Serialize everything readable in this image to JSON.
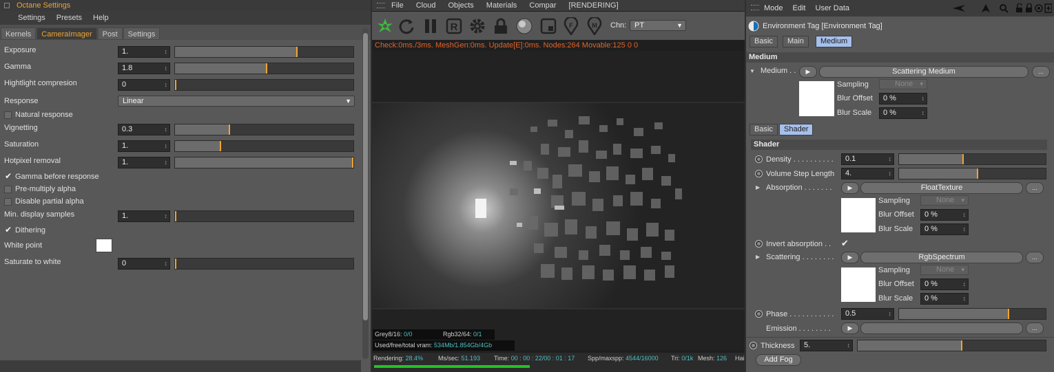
{
  "left": {
    "title": "Octane Settings",
    "menu": [
      "Settings",
      "Presets",
      "Help"
    ],
    "tabs": [
      "Kernels",
      "CameraImager",
      "Post",
      "Settings"
    ],
    "params": {
      "exposure": {
        "label": "Exposure",
        "value": "1.",
        "level": 0.68
      },
      "gamma": {
        "label": "Gamma",
        "value": "1.8",
        "level": 0.51
      },
      "highlight": {
        "label": "Hightlight compresion",
        "value": "0",
        "level": 0
      },
      "response": {
        "label": "Response",
        "value": "Linear"
      },
      "natural": {
        "label": "Natural response"
      },
      "vignetting": {
        "label": "Vignetting",
        "value": "0.3",
        "level": 0.3
      },
      "saturation": {
        "label": "Saturation",
        "value": "1.",
        "level": 0.25
      },
      "hotpixel": {
        "label": "Hotpixel removal",
        "value": "1.",
        "level": 1
      },
      "gamma_before": {
        "label": "Gamma before response"
      },
      "premultiply": {
        "label": "Pre-multiply alpha"
      },
      "disable_partial": {
        "label": "Disable partial alpha"
      },
      "min_display": {
        "label": "Min. display samples",
        "value": "1.",
        "level": 0
      },
      "dithering": {
        "label": "Dithering"
      },
      "white_point": {
        "label": "White point"
      },
      "saturate_white": {
        "label": "Saturate to white",
        "value": "0",
        "level": 0
      }
    }
  },
  "mid": {
    "menu": [
      "File",
      "Cloud",
      "Objects",
      "Materials",
      "Compar",
      "[RENDERING]"
    ],
    "chn_label": "Chn:",
    "chn_value": "PT",
    "status": "Check:0ms./3ms. MeshGen:0ms. Update[E]:0ms. Nodes:264 Movable:125  0 0",
    "info": {
      "grey_label": "Grey8/16:",
      "grey_value": "0/0",
      "rgb_label": "Rgb32/64:",
      "rgb_value": "0/1",
      "vram_label": "Used/free/total vram:",
      "vram_value": "534Mb/1.854Gb/4Gb"
    },
    "bottom": {
      "rendering_label": "Rendering:",
      "rendering_value": "28.4%",
      "ms_label": "Ms/sec:",
      "ms_value": "51.193",
      "time_label": "Time:",
      "time_value": "00 : 00 : 22/00 : 01 : 17",
      "spp_label": "Spp/maxspp:",
      "spp_value": "4544/16000",
      "tri_label": "Tri:",
      "tri_value": "0/1k",
      "mesh_label": "Mesh:",
      "mesh_value": "126",
      "extra": "Hai"
    },
    "progress": 0.284
  },
  "right": {
    "menu": [
      "Mode",
      "Edit",
      "User Data"
    ],
    "tag_title": "Environment Tag [Environment Tag]",
    "tabs": [
      "Basic",
      "Main",
      "Medium"
    ],
    "section_medium": "Medium",
    "medium_label": "Medium . .",
    "medium_value": "Scattering Medium",
    "ellipsis": "...",
    "sampling_label": "Sampling",
    "sampling_value": "None",
    "blur_offset_label": "Blur Offset",
    "blur_offset_value": "0 %",
    "blur_scale_label": "Blur Scale",
    "blur_scale_value": "0 %",
    "subtabs": [
      "Basic",
      "Shader"
    ],
    "section_shader": "Shader",
    "density": {
      "label": "Density . . . . . . . . . .",
      "value": "0.1",
      "level": 0.43
    },
    "volume_step": {
      "label": "Volume Step Length",
      "value": "4.",
      "level": 0.53
    },
    "absorption": {
      "label": "Absorption . . . . . . .",
      "value": "FloatTexture"
    },
    "invert_absorption": {
      "label": "Invert absorption . ."
    },
    "scattering": {
      "label": "Scattering . . . . . . . .",
      "value": "RgbSpectrum"
    },
    "phase": {
      "label": "Phase . . . . . . . . . . .",
      "value": "0.5",
      "level": 0.74
    },
    "emission": {
      "label": "Emission . . . . . . . ."
    },
    "thickness": {
      "label": "Thickness",
      "value": "5.",
      "level": 0.55
    },
    "add_fog": "Add Fog"
  }
}
